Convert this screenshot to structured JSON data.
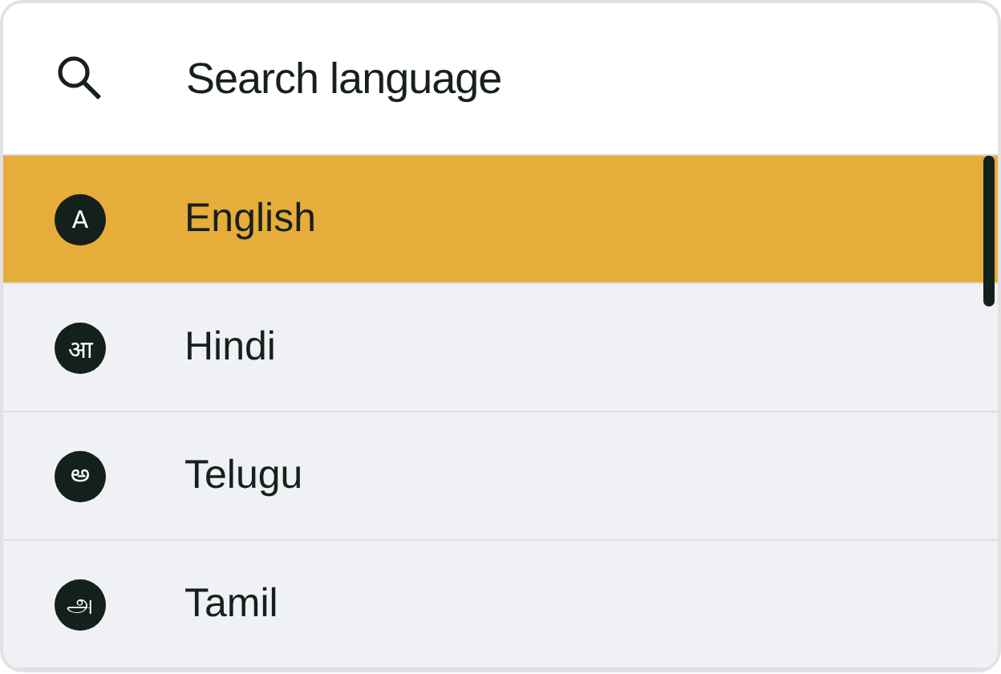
{
  "search": {
    "placeholder": "Search language"
  },
  "languages": [
    {
      "glyph": "A",
      "name": "English",
      "selected": true
    },
    {
      "glyph": "आ",
      "name": "Hindi",
      "selected": false
    },
    {
      "glyph": "అ",
      "name": "Telugu",
      "selected": false
    },
    {
      "glyph": "அ",
      "name": "Tamil",
      "selected": false
    }
  ]
}
